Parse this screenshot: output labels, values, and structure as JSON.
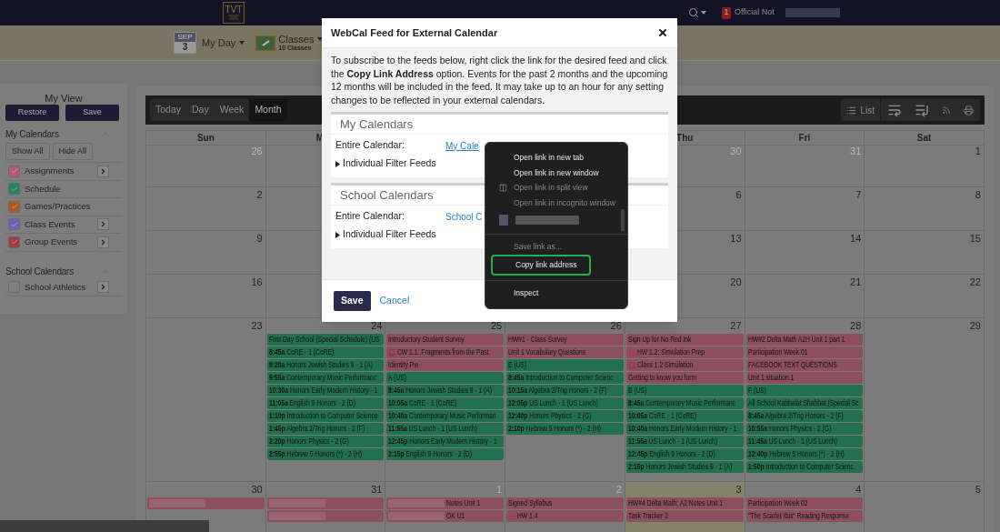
{
  "top_nav": {
    "logo": {
      "mark": "TVT"
    },
    "notification_count": "1",
    "notification_text": "Official Not"
  },
  "sub_nav": {
    "date_icon": {
      "month": "SEP",
      "day": "3"
    },
    "my_day": "My Day",
    "classes": {
      "label": "Classes",
      "count": "10 Classes"
    }
  },
  "sidebar": {
    "title": "My View",
    "buttons": [
      "Restore",
      "Save"
    ],
    "sections": [
      {
        "title": "My Calendars",
        "expanded": true,
        "actions": [
          "Show All",
          "Hide All"
        ],
        "items": [
          {
            "label": "Assignments",
            "checked": true,
            "color": "#b35a72",
            "has_submenu": true
          },
          {
            "label": "Schedule",
            "checked": true,
            "color": "#22865a",
            "has_submenu": false
          },
          {
            "label": "Games/Practices",
            "checked": true,
            "color": "#b0561f",
            "has_submenu": false
          },
          {
            "label": "Class Events",
            "checked": true,
            "color": "#6b62b3",
            "has_submenu": true
          },
          {
            "label": "Group Events",
            "checked": true,
            "color": "#9e3f3f",
            "has_submenu": true
          }
        ]
      },
      {
        "title": "School Calendars",
        "expanded": true,
        "items": [
          {
            "label": "School Athletics",
            "checked": false,
            "has_submenu": true
          }
        ]
      }
    ]
  },
  "calendar": {
    "views": [
      {
        "label": "Today",
        "selected": false
      },
      {
        "label": "Day",
        "selected": false
      },
      {
        "label": "Week",
        "selected": false
      },
      {
        "label": "Month",
        "selected": true
      }
    ],
    "list_label": "List",
    "day_headers_left": [
      "Sun",
      "M"
    ],
    "day_headers_right": [
      "Thu",
      "Fri",
      "Sat"
    ],
    "covered_weeks": [
      {
        "left": [
          {
            "date": "26",
            "muted": true,
            "today": false
          }
        ],
        "right": [
          {
            "date": "30",
            "muted": true,
            "today": false
          },
          {
            "date": "31",
            "muted": true,
            "today": false
          },
          {
            "date": "1",
            "muted": false,
            "today": false
          }
        ]
      },
      {
        "left": [
          {
            "date": "2",
            "muted": false,
            "today": false
          }
        ],
        "right": [
          {
            "date": "6",
            "muted": false,
            "today": false
          },
          {
            "date": "7",
            "muted": false,
            "today": false
          },
          {
            "date": "8",
            "muted": false,
            "today": false
          }
        ]
      },
      {
        "left": [
          {
            "date": "9",
            "muted": false,
            "today": false
          }
        ],
        "right": [
          {
            "date": "13",
            "muted": false,
            "today": false
          },
          {
            "date": "14",
            "muted": false,
            "today": false
          },
          {
            "date": "15",
            "muted": false,
            "today": false
          }
        ]
      },
      {
        "left": [
          {
            "date": "16",
            "muted": false,
            "today": false
          }
        ],
        "right": [
          {
            "date": "20",
            "muted": false,
            "today": false
          },
          {
            "date": "21",
            "muted": false,
            "today": false
          },
          {
            "date": "22",
            "muted": false,
            "today": false
          }
        ]
      }
    ],
    "weeks": [
      [
        {
          "date": "23",
          "muted": false,
          "today": false
        },
        {
          "date": "24",
          "muted": false,
          "today": false,
          "events": [
            {
              "kind": "schedule",
              "title": "First Day School (Special Schedule) (US"
            },
            {
              "kind": "schedule",
              "title": "**8:45a** CoRE - 1 (CoRE)"
            },
            {
              "kind": "schedule",
              "title": "**9:20a** Honors Jewish Studies 9 - 1 (A)"
            },
            {
              "kind": "schedule",
              "title": "**9:55a** Contemporary Music Performanc"
            },
            {
              "kind": "schedule",
              "title": "**10:30a** Honors Early Modern History - 1"
            },
            {
              "kind": "schedule",
              "title": "**11:05a** English 9 Honors - 2 (D)"
            },
            {
              "kind": "schedule",
              "title": "**1:10p** Introduction to Computer Science"
            },
            {
              "kind": "schedule",
              "title": "**1:45p** Algebra 2/Trig Honors - 2 (F)"
            },
            {
              "kind": "schedule",
              "title": "**2:20p** Honors Physics - 2 (G)"
            },
            {
              "kind": "schedule",
              "title": "**2:55p** Hebrew 5 Honors (*) - 2 (H)"
            }
          ]
        },
        {
          "date": "25",
          "muted": false,
          "today": false,
          "events": [
            {
              "kind": "assignment",
              "title": "Introductory Student Survey"
            },
            {
              "kind": "material_assignment",
              "title": "CW 1.1: Fragments from the Past"
            },
            {
              "kind": "assignment",
              "title": "Identity Pie"
            },
            {
              "kind": "schedule",
              "title": "A (US)"
            },
            {
              "kind": "schedule",
              "title": "**8:45a** Honors Jewish Studies 9 - 1 (A)"
            },
            {
              "kind": "schedule",
              "title": "**10:05a** CoRE - 1 (CoRE)"
            },
            {
              "kind": "schedule",
              "title": "**10:40a** Contemporary Music Performan"
            },
            {
              "kind": "schedule",
              "title": "**11:55a** US Lunch - 1 (US Lunch)"
            },
            {
              "kind": "schedule",
              "title": "**12:45p** Honors Early Modern History - 1"
            },
            {
              "kind": "schedule",
              "title": "**2:15p** English 9 Honors - 2 (D)"
            }
          ]
        },
        {
          "date": "26",
          "muted": false,
          "today": false,
          "events": [
            {
              "kind": "assignment",
              "title": "HW#1 - Class Survey"
            },
            {
              "kind": "assignment",
              "title": "Unit 1 Vocabulary Questions"
            },
            {
              "kind": "schedule",
              "title": "E (US)"
            },
            {
              "kind": "schedule",
              "title": "**8:45a** Introduction to Computer Scienc"
            },
            {
              "kind": "schedule",
              "title": "**10:15a** Algebra 2/Trig Honors - 2 (F)"
            },
            {
              "kind": "schedule",
              "title": "**12:05p** US Lunch - 1 (US Lunch)"
            },
            {
              "kind": "schedule",
              "title": "**12:40p** Honors Physics - 2 (G)"
            },
            {
              "kind": "schedule",
              "title": "**2:10p** Hebrew 5 Honors (*) - 2 (H)"
            }
          ]
        },
        {
          "date": "27",
          "muted": false,
          "today": false,
          "events": [
            {
              "kind": "assignment",
              "title": "Sign Up for No Red Ink"
            },
            {
              "kind": "locked_assignment",
              "title": "HW 1.2: Simulation Prep"
            },
            {
              "kind": "material_assignment",
              "title": "Class 1.2 Simulation"
            },
            {
              "kind": "assignment",
              "title": "Getting to know you form"
            },
            {
              "kind": "schedule",
              "title": "B (US)"
            },
            {
              "kind": "schedule",
              "title": "**8:45a** Contemporary Music Performanc"
            },
            {
              "kind": "schedule",
              "title": "**10:05a** CoRE - 1 (CoRE)"
            },
            {
              "kind": "schedule",
              "title": "**10:40a** Honors Early Modern History - 1"
            },
            {
              "kind": "schedule",
              "title": "**11:55a** US Lunch - 1 (US Lunch)"
            },
            {
              "kind": "schedule",
              "title": "**12:45p** English 9 Honors - 2 (D)"
            },
            {
              "kind": "schedule",
              "title": "**2:15p** Honors Jewish Studies 9 - 1 (A)"
            }
          ]
        },
        {
          "date": "28",
          "muted": false,
          "today": false,
          "events": [
            {
              "kind": "assignment",
              "title": "HW#2 Delta Math A2H  Unit 1 part 1"
            },
            {
              "kind": "assignment",
              "title": "Participation Week 01"
            },
            {
              "kind": "assignment",
              "title": "FACEBOOK TEXT QUESTIONS"
            },
            {
              "kind": "assignment",
              "title": "Unit 1 situation 1"
            },
            {
              "kind": "schedule",
              "title": "F (US)"
            },
            {
              "kind": "schedule",
              "title": "All School Kabbalat Shabbat (Special Sc"
            },
            {
              "kind": "schedule",
              "title": "**8:45a** Algebra 2/Trig Honors - 2 (F)"
            },
            {
              "kind": "schedule",
              "title": "**10:55a** Honors Physics - 2 (G)"
            },
            {
              "kind": "schedule",
              "title": "**11:45a** US Lunch - 1 (US Lunch)"
            },
            {
              "kind": "schedule",
              "title": "**12:40p** Hebrew 5 Honors (*) - 2 (H)"
            },
            {
              "kind": "schedule",
              "title": "**1:50p** Introduction to Computer Scienc"
            }
          ]
        },
        {
          "date": "29",
          "muted": false,
          "today": false
        }
      ],
      [
        {
          "date": "30",
          "muted": false,
          "today": false,
          "events": [
            {
              "kind": "assignment",
              "redacted": true
            }
          ]
        },
        {
          "date": "31",
          "muted": false,
          "today": false,
          "events": [
            {
              "kind": "assignment",
              "redacted": true
            },
            {
              "kind": "assignment",
              "redacted": true
            }
          ]
        },
        {
          "date": "1",
          "muted": true,
          "today": false,
          "events": [
            {
              "kind": "assignment",
              "redacted": true,
              "title": "Notes Unit 1"
            },
            {
              "kind": "assignment",
              "redacted": true,
              "title": "OK U1"
            }
          ]
        },
        {
          "date": "2",
          "muted": true,
          "today": false,
          "events": [
            {
              "kind": "assignment",
              "title": "Signed Syllabus"
            },
            {
              "kind": "locked_assignment",
              "title": "HW 1.4"
            }
          ]
        },
        {
          "date": "3",
          "muted": false,
          "today": true,
          "events": [
            {
              "kind": "assignment",
              "title": "HW#4 Delta Math: A2 Notes Unit 1"
            },
            {
              "kind": "assignment",
              "title": "Task Tracker 2"
            }
          ]
        },
        {
          "date": "4",
          "muted": false,
          "today": false,
          "events": [
            {
              "kind": "assignment",
              "title": "Participation Week 02"
            },
            {
              "kind": "assignment",
              "title": "\"The Scarlet Ibis\"  Reading Response"
            }
          ]
        },
        {
          "date": "5",
          "muted": false,
          "today": false
        }
      ]
    ]
  },
  "feed_dialog": {
    "title": "WebCal Feed for External Calendar",
    "intro": "To subscribe to the feeds below, right click the link for the desired feed and click the **Copy Link Address** option. Events for the past 2 months and the upcoming 12 months will be included in the feed. It may take up to an hour for any setting changes to be reflected in your external calendars.",
    "sections": [
      {
        "title": "My Calendars",
        "label": "Entire Calendar:",
        "link": "My Cale",
        "hovered": true,
        "filters": "Individual Filter Feeds"
      },
      {
        "title": "School Calendars",
        "label": "Entire Calendar:",
        "link": "School C",
        "hovered": false,
        "filters": "Individual Filter Feeds"
      }
    ],
    "save": "Save",
    "cancel": "Cancel"
  },
  "context_menu": {
    "items": [
      {
        "kind": "item",
        "label": "Open link in new tab",
        "disabled": false,
        "outlined": false
      },
      {
        "kind": "item",
        "label": "Open link in new window",
        "disabled": false,
        "outlined": false
      },
      {
        "kind": "split_view_item",
        "label": "Open link in split view",
        "disabled": true,
        "outlined": false
      },
      {
        "kind": "item",
        "label": "Open link in incognito window",
        "disabled": true,
        "outlined": false
      },
      {
        "kind": "profile"
      },
      {
        "kind": "divider"
      },
      {
        "kind": "item",
        "label": "Save link as...",
        "disabled": true,
        "outlined": false
      },
      {
        "kind": "item",
        "label": "Copy link address",
        "disabled": false,
        "outlined": true
      },
      {
        "kind": "divider"
      },
      {
        "kind": "item",
        "label": "Inspect",
        "disabled": false,
        "outlined": false
      }
    ]
  }
}
